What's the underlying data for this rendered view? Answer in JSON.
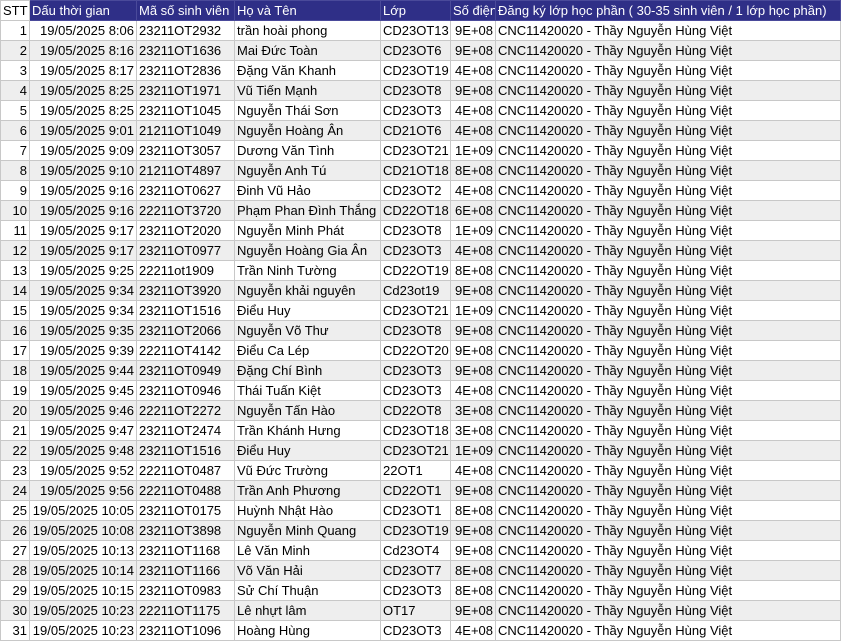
{
  "headers": {
    "stt": "STT",
    "time": "Dấu thời gian",
    "id": "Mã số sinh viên",
    "name": "Họ và Tên",
    "class": "Lớp",
    "phone": "Số điện",
    "course": "Đăng ký lớp học phần ( 30-35 sinh viên / 1 lớp học phần)"
  },
  "colors": {
    "header_bg": "#2f2f87",
    "header_text": "#ffffff",
    "stripe": "#eeeeee",
    "grid": "#c8c8c8"
  },
  "rows": [
    {
      "stt": "1",
      "time": "19/05/2025 8:06",
      "id": "23211OT2932",
      "name": "trần hoài phong",
      "class": "CD23OT13",
      "phone": "9E+08",
      "course": "CNC11420020 - Thầy Nguyễn Hùng Việt"
    },
    {
      "stt": "2",
      "time": "19/05/2025 8:16",
      "id": "23211OT1636",
      "name": "Mai Đức Toàn",
      "class": "CD23OT6",
      "phone": "9E+08",
      "course": "CNC11420020 - Thầy Nguyễn Hùng Việt"
    },
    {
      "stt": "3",
      "time": "19/05/2025 8:17",
      "id": "23211OT2836",
      "name": "Đặng Văn Khanh",
      "class": "CD23OT19",
      "phone": "4E+08",
      "course": "CNC11420020 - Thầy Nguyễn Hùng Việt"
    },
    {
      "stt": "4",
      "time": "19/05/2025 8:25",
      "id": "23211OT1971",
      "name": "Vũ Tiến Mạnh",
      "class": "CD23OT8",
      "phone": "9E+08",
      "course": "CNC11420020 - Thầy Nguyễn Hùng Việt"
    },
    {
      "stt": "5",
      "time": "19/05/2025 8:25",
      "id": "23211OT1045",
      "name": "Nguyễn Thái Sơn",
      "class": "CD23OT3",
      "phone": "4E+08",
      "course": "CNC11420020 - Thầy Nguyễn Hùng Việt"
    },
    {
      "stt": "6",
      "time": "19/05/2025 9:01",
      "id": "21211OT1049",
      "name": "Nguyễn Hoàng Ân",
      "class": "CD21OT6",
      "phone": "4E+08",
      "course": "CNC11420020 - Thầy Nguyễn Hùng Việt"
    },
    {
      "stt": "7",
      "time": "19/05/2025 9:09",
      "id": "23211OT3057",
      "name": "Dương Văn Tình",
      "class": "CD23OT21",
      "phone": "1E+09",
      "course": "CNC11420020 - Thầy Nguyễn Hùng Việt"
    },
    {
      "stt": "8",
      "time": "19/05/2025 9:10",
      "id": "21211OT4897",
      "name": "Nguyễn Anh Tú",
      "class": "CD21OT18",
      "phone": "8E+08",
      "course": "CNC11420020 - Thầy Nguyễn Hùng Việt"
    },
    {
      "stt": "9",
      "time": "19/05/2025 9:16",
      "id": "23211OT0627",
      "name": "Đinh Vũ Hảo",
      "class": "CD23OT2",
      "phone": "4E+08",
      "course": "CNC11420020 - Thầy Nguyễn Hùng Việt"
    },
    {
      "stt": "10",
      "time": "19/05/2025 9:16",
      "id": "22211OT3720",
      "name": "Phạm Phan Đình Thắng",
      "class": "CD22OT18",
      "phone": "6E+08",
      "course": "CNC11420020 - Thầy Nguyễn Hùng Việt"
    },
    {
      "stt": "11",
      "time": "19/05/2025 9:17",
      "id": "23211OT2020",
      "name": "Nguyễn Minh Phát",
      "class": "CD23OT8",
      "phone": "1E+09",
      "course": "CNC11420020 - Thầy Nguyễn Hùng Việt"
    },
    {
      "stt": "12",
      "time": "19/05/2025 9:17",
      "id": "23211OT0977",
      "name": "Nguyễn Hoàng Gia Ân",
      "class": "CD23OT3",
      "phone": "4E+08",
      "course": "CNC11420020 - Thầy Nguyễn Hùng Việt"
    },
    {
      "stt": "13",
      "time": "19/05/2025 9:25",
      "id": "22211ot1909",
      "name": "Trần Ninh Tường",
      "class": "CD22OT19",
      "phone": "8E+08",
      "course": "CNC11420020 - Thầy Nguyễn Hùng Việt"
    },
    {
      "stt": "14",
      "time": "19/05/2025 9:34",
      "id": "23211OT3920",
      "name": "Nguyễn khải nguyên",
      "class": "Cd23ot19",
      "phone": "9E+08",
      "course": "CNC11420020 - Thầy Nguyễn Hùng Việt"
    },
    {
      "stt": "15",
      "time": "19/05/2025 9:34",
      "id": "23211OT1516",
      "name": "Điểu Huy",
      "class": "CD23OT21",
      "phone": "1E+09",
      "course": "CNC11420020 - Thầy Nguyễn Hùng Việt"
    },
    {
      "stt": "16",
      "time": "19/05/2025 9:35",
      "id": "23211OT2066",
      "name": "Nguyễn Võ Thư",
      "class": "CD23OT8",
      "phone": "9E+08",
      "course": "CNC11420020 - Thầy Nguyễn Hùng Việt"
    },
    {
      "stt": "17",
      "time": "19/05/2025 9:39",
      "id": "22211OT4142",
      "name": "Điểu Ca Lép",
      "class": "CD22OT20",
      "phone": "9E+08",
      "course": "CNC11420020 - Thầy Nguyễn Hùng Việt"
    },
    {
      "stt": "18",
      "time": "19/05/2025 9:44",
      "id": "23211OT0949",
      "name": "Đặng Chí Bình",
      "class": "CD23OT3",
      "phone": "9E+08",
      "course": "CNC11420020 - Thầy Nguyễn Hùng Việt"
    },
    {
      "stt": "19",
      "time": "19/05/2025 9:45",
      "id": "23211OT0946",
      "name": "Thái Tuấn Kiệt",
      "class": "CD23OT3",
      "phone": "4E+08",
      "course": "CNC11420020 - Thầy Nguyễn Hùng Việt"
    },
    {
      "stt": "20",
      "time": "19/05/2025 9:46",
      "id": "22211OT2272",
      "name": "Nguyễn Tấn Hào",
      "class": "CD22OT8",
      "phone": "3E+08",
      "course": "CNC11420020 - Thầy Nguyễn Hùng Việt"
    },
    {
      "stt": "21",
      "time": "19/05/2025 9:47",
      "id": "23211OT2474",
      "name": "Trần Khánh Hưng",
      "class": "CD23OT18",
      "phone": "3E+08",
      "course": "CNC11420020 - Thầy Nguyễn Hùng Việt"
    },
    {
      "stt": "22",
      "time": "19/05/2025 9:48",
      "id": "23211OT1516",
      "name": "Điểu Huy",
      "class": "CD23OT21",
      "phone": "1E+09",
      "course": "CNC11420020 - Thầy Nguyễn Hùng Việt"
    },
    {
      "stt": "23",
      "time": "19/05/2025 9:52",
      "id": "22211OT0487",
      "name": "Vũ Đức Trường",
      "class": "22OT1",
      "phone": "4E+08",
      "course": "CNC11420020 - Thầy Nguyễn Hùng Việt"
    },
    {
      "stt": "24",
      "time": "19/05/2025 9:56",
      "id": "22211OT0488",
      "name": "Trần Anh Phương",
      "class": "CD22OT1",
      "phone": "9E+08",
      "course": "CNC11420020 - Thầy Nguyễn Hùng Việt"
    },
    {
      "stt": "25",
      "time": "19/05/2025 10:05",
      "id": "23211OT0175",
      "name": "Huỳnh Nhật Hào",
      "class": "CD23OT1",
      "phone": "8E+08",
      "course": "CNC11420020 - Thầy Nguyễn Hùng Việt"
    },
    {
      "stt": "26",
      "time": "19/05/2025 10:08",
      "id": "23211OT3898",
      "name": "Nguyễn Minh Quang",
      "class": "CD23OT19",
      "phone": "9E+08",
      "course": "CNC11420020 - Thầy Nguyễn Hùng Việt"
    },
    {
      "stt": "27",
      "time": "19/05/2025 10:13",
      "id": "23211OT1168",
      "name": "Lê Văn Minh",
      "class": "Cd23OT4",
      "phone": "9E+08",
      "course": "CNC11420020 - Thầy Nguyễn Hùng Việt"
    },
    {
      "stt": "28",
      "time": "19/05/2025 10:14",
      "id": "23211OT1166",
      "name": "Võ Văn Hải",
      "class": "CD23OT7",
      "phone": "8E+08",
      "course": "CNC11420020 - Thầy Nguyễn Hùng Việt"
    },
    {
      "stt": "29",
      "time": "19/05/2025 10:15",
      "id": "23211OT0983",
      "name": "Sử Chí Thuận",
      "class": "CD23OT3",
      "phone": "8E+08",
      "course": "CNC11420020 - Thầy Nguyễn Hùng Việt"
    },
    {
      "stt": "30",
      "time": "19/05/2025 10:23",
      "id": "22211OT1175",
      "name": "Lê nhựt lâm",
      "class": "OT17",
      "phone": "9E+08",
      "course": "CNC11420020 - Thầy Nguyễn Hùng Việt"
    },
    {
      "stt": "31",
      "time": "19/05/2025 10:23",
      "id": "23211OT1096",
      "name": "Hoàng Hùng",
      "class": "CD23OT3",
      "phone": "4E+08",
      "course": "CNC11420020 - Thầy Nguyễn Hùng Việt"
    }
  ]
}
